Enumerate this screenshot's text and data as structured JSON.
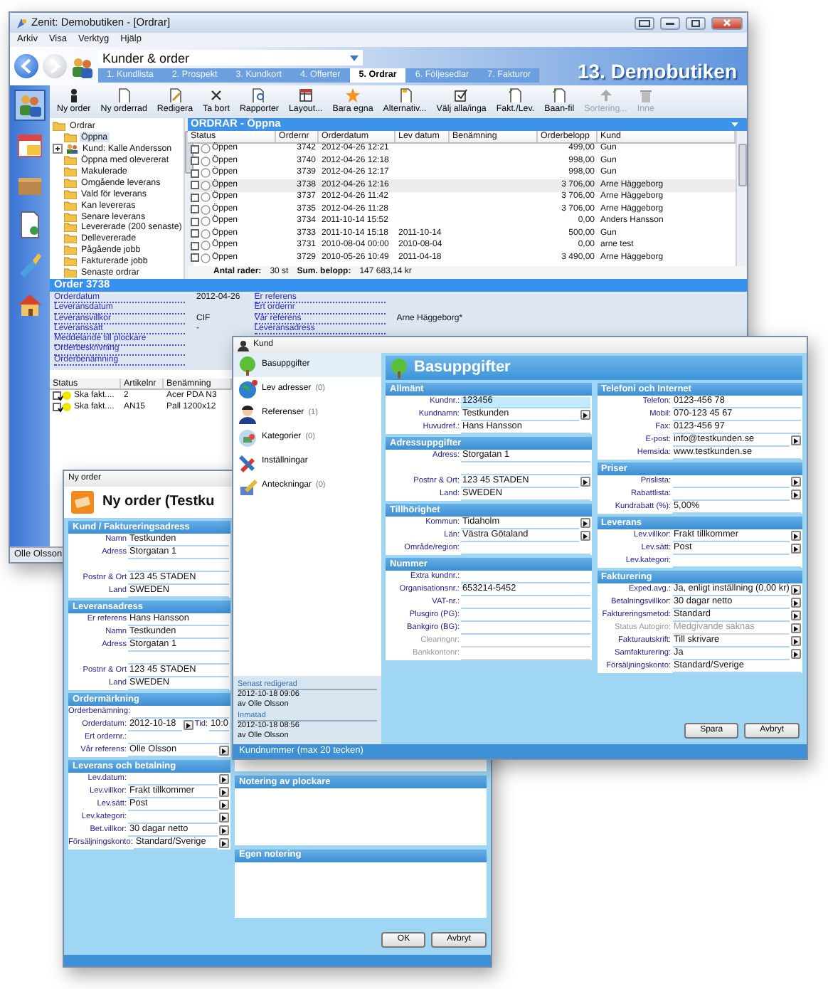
{
  "main_window": {
    "title": "Zenit: Demobutiken - [Ordrar]",
    "menu": [
      "Arkiv",
      "Visa",
      "Verktyg",
      "Hjälp"
    ],
    "nav_dropdown": "Kunder & order",
    "tabs": [
      {
        "label": "1. Kundlista",
        "selected": false
      },
      {
        "label": "2. Prospekt",
        "selected": false
      },
      {
        "label": "3. Kundkort",
        "selected": false
      },
      {
        "label": "4. Offerter",
        "selected": false
      },
      {
        "label": "5. Ordrar",
        "selected": true
      },
      {
        "label": "6. Följesedlar",
        "selected": false
      },
      {
        "label": "7. Fakturor",
        "selected": false
      }
    ],
    "company": "13. Demobutiken",
    "sidebar": [
      {
        "selected": true
      },
      {
        "selected": false
      },
      {
        "selected": false
      },
      {
        "selected": false
      },
      {
        "selected": false
      },
      {
        "selected": false
      }
    ],
    "toolbar": [
      {
        "label": "Ny order",
        "disabled": false
      },
      {
        "label": "Ny orderrad",
        "disabled": false
      },
      {
        "label": "Redigera",
        "disabled": false
      },
      {
        "label": "Ta bort",
        "disabled": false
      },
      {
        "label": "Rapporter",
        "disabled": false
      },
      {
        "label": "Layout...",
        "disabled": false
      },
      {
        "label": "Bara egna",
        "disabled": false
      },
      {
        "label": "Alternativ...",
        "disabled": false
      },
      {
        "label": "Välj alla/inga",
        "disabled": false
      },
      {
        "label": "Fakt./Lev.",
        "disabled": false
      },
      {
        "label": "Baan-fil",
        "disabled": false
      },
      {
        "label": "Sortering...",
        "disabled": true
      },
      {
        "label": "Inne",
        "disabled": true
      }
    ],
    "tree": {
      "label": "Ordrar",
      "expanded": true,
      "children": [
        {
          "label": "Öppna",
          "kind": "folder",
          "selected": true
        },
        {
          "label": "Kund: Kalle Andersson",
          "kind": "customer",
          "selected": false,
          "expanded": false
        },
        {
          "label": "Öppna med olevererat",
          "kind": "folder",
          "selected": false
        },
        {
          "label": "Makulerade",
          "kind": "folder",
          "selected": false
        },
        {
          "label": "Omgående leverans",
          "kind": "folder",
          "selected": false
        },
        {
          "label": "Vald för leverans",
          "kind": "folder",
          "selected": false
        },
        {
          "label": "Kan levereras",
          "kind": "folder",
          "selected": false
        },
        {
          "label": "Senare leverans",
          "kind": "folder",
          "selected": false
        },
        {
          "label": "Levererade (200 senaste)",
          "kind": "folder",
          "selected": false
        },
        {
          "label": "Dellevererade",
          "kind": "folder",
          "selected": false
        },
        {
          "label": "Pågående jobb",
          "kind": "folder",
          "selected": false
        },
        {
          "label": "Fakturerade jobb",
          "kind": "folder",
          "selected": false
        },
        {
          "label": "Senaste ordrar",
          "kind": "folder",
          "selected": false
        }
      ]
    },
    "grid": {
      "title": "ORDRAR - Öppna",
      "columns": [
        "Status",
        "Ordernr",
        "Orderdatum",
        "Lev datum",
        "Benämning",
        "Orderbelopp",
        "Kund"
      ],
      "rows": [
        {
          "checked": false,
          "selected": false,
          "status": "Öppen",
          "ordernr": "3742",
          "orderdatum": "2012-04-26 12:21",
          "belopp": "499,00",
          "kund": "Gun"
        },
        {
          "checked": false,
          "selected": false,
          "status": "Öppen",
          "ordernr": "3740",
          "orderdatum": "2012-04-26 12:18",
          "belopp": "998,00",
          "kund": "Gun"
        },
        {
          "checked": false,
          "selected": false,
          "status": "Öppen",
          "ordernr": "3739",
          "orderdatum": "2012-04-26 12:17",
          "belopp": "998,00",
          "kund": "Gun"
        },
        {
          "checked": false,
          "selected": true,
          "status": "Öppen",
          "ordernr": "3738",
          "orderdatum": "2012-04-26 12:16",
          "belopp": "3 706,00",
          "kund": "Arne Häggeborg"
        },
        {
          "checked": false,
          "selected": false,
          "status": "Öppen",
          "ordernr": "3737",
          "orderdatum": "2012-04-26 11:42",
          "belopp": "3 706,00",
          "kund": "Arne Häggeborg"
        },
        {
          "checked": false,
          "selected": false,
          "status": "Öppen",
          "ordernr": "3735",
          "orderdatum": "2012-04-26 11:28",
          "belopp": "3 706,00",
          "kund": "Arne Häggeborg"
        },
        {
          "checked": false,
          "selected": false,
          "status": "Öppen",
          "ordernr": "3734",
          "orderdatum": "2011-10-14 15:52",
          "belopp": "0,00",
          "kund": "Anders Hansson"
        },
        {
          "checked": false,
          "selected": false,
          "status": "Öppen",
          "ordernr": "3733",
          "orderdatum": "2011-10-14 15:18",
          "lev_datum": "2011-10-14",
          "belopp": "500,00",
          "kund": "Gun"
        },
        {
          "checked": false,
          "selected": false,
          "status": "Öppen",
          "ordernr": "3731",
          "orderdatum": "2010-08-04 00:00",
          "lev_datum": "2010-08-04",
          "belopp": "0,00",
          "kund": "arne test"
        },
        {
          "checked": false,
          "selected": false,
          "status": "Öppen",
          "ordernr": "3729",
          "orderdatum": "2010-05-26 10:49",
          "lev_datum": "2011-04-18",
          "belopp": "3 490,00",
          "kund": "Arne Häggeborg"
        }
      ],
      "footer": [
        {
          "label": "Antal rader:",
          "value": "30 st"
        },
        {
          "label": "Sum. belopp:",
          "value": "147 683,14 kr"
        }
      ]
    },
    "order_panel": {
      "title": "Order 3738",
      "left_fields": [
        {
          "label": "Orderdatum",
          "value": "2012-04-26"
        },
        {
          "label": "Leveransdatum"
        },
        {
          "label": "Leveransvillkor",
          "value": "CIF"
        },
        {
          "label": "Leveranssätt",
          "value": "-"
        },
        {
          "label": "Meddelande till plockare"
        },
        {
          "label": "Orderbeskrivning"
        },
        {
          "label": "Orderbenämning"
        }
      ],
      "right_fields": [
        {
          "label": "Er referens"
        },
        {
          "label": "Ert ordernr"
        },
        {
          "label": "Vår referens",
          "value": "Arne Häggeborg*"
        },
        {
          "label": "Leveransadress"
        }
      ],
      "lines": {
        "columns": [
          "Status",
          "Artikelnr",
          "Benämning"
        ],
        "rows": [
          {
            "checked": true,
            "color": "#f2e600",
            "status": "Ska fakt....",
            "artikelnr": "2",
            "benamning": "Acer PDA N3"
          },
          {
            "checked": true,
            "color": "#f2e600",
            "status": "Ska fakt....",
            "artikelnr": "AN15",
            "benamning": "Pall 1200x12"
          }
        ]
      }
    },
    "status_bar": "Olle Olsson"
  },
  "order_window": {
    "title": "Ny order",
    "heading": "Ny order (Testku",
    "sections": [
      {
        "title": "Kund / Faktureringsadress",
        "fields": [
          {
            "label": "Namn",
            "value": "Testkunden",
            "picker": false
          },
          {
            "label": "Adress",
            "value": "Storgatan 1",
            "picker": false
          },
          {
            "picker": false
          },
          {
            "label": "Postnr & Ort",
            "value": "123 45  STADEN",
            "picker": false
          },
          {
            "label": "Land",
            "value": "SWEDEN",
            "picker": false
          }
        ]
      },
      {
        "title": "Leveransadress",
        "fields": [
          {
            "label": "Er referens",
            "value": "Hans Hansson",
            "picker": false
          },
          {
            "label": "Namn",
            "value": "Testkunden",
            "picker": false
          },
          {
            "label": "Adress",
            "value": "Storgatan 1",
            "picker": false
          },
          {
            "picker": false
          },
          {
            "label": "Postnr & Ort",
            "value": "123 45  STADEN",
            "picker": false
          },
          {
            "label": "Land",
            "value": "SWEDEN",
            "picker": false
          }
        ]
      },
      {
        "title": "Ordermärkning",
        "fields": [
          {
            "label": "Orderbenämning:",
            "picker": false
          },
          {
            "label": "Orderdatum:",
            "value": "2012-10-18",
            "picker": true,
            "extra_label": "Tid:",
            "extra_value": "10:0"
          },
          {
            "label": "Ert ordernr.:",
            "picker": false
          },
          {
            "label": "Vår referens:",
            "value": "Olle Olsson",
            "picker": true
          }
        ]
      },
      {
        "title": "Leverans och betalning",
        "fields": [
          {
            "label": "Lev.datum:",
            "picker": true
          },
          {
            "label": "Lev.villkor:",
            "value": "Frakt tillkommer",
            "picker": true
          },
          {
            "label": "Lev.sätt:",
            "value": "Post",
            "picker": true
          },
          {
            "label": "Lev.kategori:",
            "picker": true
          },
          {
            "label": "Bet.villkor:",
            "value": "30 dagar netto",
            "picker": true
          },
          {
            "label": "Försäljningskonto:",
            "value": "Standard/Sverige",
            "picker": true
          }
        ]
      }
    ],
    "notes": [
      "Notering av plockare",
      "Egen notering"
    ],
    "buttons": [
      "OK",
      "Avbryt"
    ]
  },
  "customer_window": {
    "title": "Kund",
    "nav": [
      {
        "label": "Basuppgifter",
        "selected": true
      },
      {
        "label": "Lev adresser",
        "count": "(0)",
        "selected": false
      },
      {
        "label": "Referenser",
        "count": "(1)",
        "selected": false
      },
      {
        "label": "Kategorier",
        "count": "(0)",
        "selected": false
      },
      {
        "label": "Inställningar",
        "selected": false
      },
      {
        "label": "Anteckningar",
        "count": "(0)",
        "selected": false
      }
    ],
    "meta": [
      {
        "label": "Senast redigerad",
        "date": "2012-10-18 09:06",
        "by": "av Olle Olsson"
      },
      {
        "label": "Inmatad",
        "date": "2012-10-18 08:56",
        "by": "av Olle Olsson"
      }
    ],
    "heading": "Basuppgifter",
    "columns": [
      [
        {
          "title": "Allmänt",
          "fields": [
            {
              "label": "Kundnr.:",
              "value": "123456",
              "picker": false,
              "selected": true,
              "disabled": false
            },
            {
              "label": "Kundnamn:",
              "value": "Testkunden",
              "picker": true,
              "selected": false,
              "disabled": false
            },
            {
              "label": "Huvudref.:",
              "value": "Hans Hansson",
              "picker": false,
              "selected": false,
              "disabled": false
            }
          ]
        },
        {
          "title": "Adressuppgifter",
          "fields": [
            {
              "label": "Adress:",
              "value": "Storgatan 1",
              "picker": false,
              "selected": false,
              "disabled": false
            },
            {
              "picker": false,
              "selected": false,
              "disabled": false
            },
            {
              "label": "Postnr & Ort:",
              "value": "123 45  STADEN",
              "picker": true,
              "selected": false,
              "disabled": false
            },
            {
              "label": "Land:",
              "value": "SWEDEN",
              "picker": false,
              "selected": false,
              "disabled": false
            }
          ]
        },
        {
          "title": "Tillhörighet",
          "fields": [
            {
              "label": "Kommun:",
              "value": "Tidaholm",
              "picker": true,
              "selected": false,
              "disabled": false
            },
            {
              "label": "Län:",
              "value": "Västra Götaland",
              "picker": true,
              "selected": false,
              "disabled": false
            },
            {
              "label": "Område/region:",
              "picker": false,
              "selected": false,
              "disabled": false
            }
          ]
        },
        {
          "title": "Nummer",
          "fields": [
            {
              "label": "Extra kundnr.:",
              "picker": false,
              "selected": false,
              "disabled": false
            },
            {
              "label": "Organisationsnr.:",
              "value": "653214-5452",
              "picker": false,
              "selected": false,
              "disabled": false
            },
            {
              "label": "VAT-nr.:",
              "picker": false,
              "selected": false,
              "disabled": false
            },
            {
              "label": "Plusgiro (PG):",
              "picker": false,
              "selected": false,
              "disabled": false
            },
            {
              "label": "Bankgiro (BG):",
              "picker": false,
              "selected": false,
              "disabled": false
            },
            {
              "label": "Clearingnr:",
              "picker": false,
              "selected": false,
              "disabled": true
            },
            {
              "label": "Bankkontonr:",
              "picker": false,
              "selected": false,
              "disabled": true
            }
          ]
        }
      ],
      [
        {
          "title": "Telefoni och Internet",
          "fields": [
            {
              "label": "Telefon:",
              "value": "0123-456 78",
              "picker": false,
              "selected": false,
              "disabled": false
            },
            {
              "label": "Mobil:",
              "value": "070-123 45 67",
              "picker": false,
              "selected": false,
              "disabled": false
            },
            {
              "label": "Fax:",
              "value": "0123-456 97",
              "picker": false,
              "selected": false,
              "disabled": false
            },
            {
              "label": "E-post:",
              "value": "info@testkunden.se",
              "picker": true,
              "selected": false,
              "disabled": false
            },
            {
              "label": "Hemsida:",
              "value": "www.testkunden.se",
              "picker": false,
              "selected": false,
              "disabled": false
            }
          ]
        },
        {
          "title": "Priser",
          "fields": [
            {
              "label": "Prislista:",
              "picker": true,
              "selected": false,
              "disabled": false
            },
            {
              "label": "Rabattlista:",
              "picker": true,
              "selected": false,
              "disabled": false
            },
            {
              "label": "Kundrabatt (%):",
              "value": "5,00%",
              "picker": false,
              "selected": false,
              "disabled": false
            }
          ]
        },
        {
          "title": "Leverans",
          "fields": [
            {
              "label": "Lev.villkor:",
              "value": "Frakt tillkommer",
              "picker": true,
              "selected": false,
              "disabled": false
            },
            {
              "label": "Lev.sätt:",
              "value": "Post",
              "picker": true,
              "selected": false,
              "disabled": false
            },
            {
              "label": "Lev.kategori:",
              "picker": false,
              "selected": false,
              "disabled": false
            }
          ]
        },
        {
          "title": "Fakturering",
          "fields": [
            {
              "label": "Exped.avg.:",
              "value": "Ja, enligt inställning (0,00 kr)",
              "picker": true,
              "selected": false,
              "disabled": false
            },
            {
              "label": "Betalningsvillkor:",
              "value": "30 dagar netto",
              "picker": true,
              "selected": false,
              "disabled": false
            },
            {
              "label": "Faktureringsmetod:",
              "value": "Standard",
              "picker": true,
              "selected": false,
              "disabled": false
            },
            {
              "label": "Status Autogiro:",
              "value": "Medgivande saknas",
              "picker": true,
              "selected": false,
              "disabled": true
            },
            {
              "label": "Fakturautskrift:",
              "value": "Till skrivare",
              "picker": true,
              "selected": false,
              "disabled": false
            },
            {
              "label": "Samfakturering:",
              "value": "Ja",
              "picker": true,
              "selected": false,
              "disabled": false
            },
            {
              "label": "Försäljningskonto:",
              "value": "Standard/Sverige",
              "picker": false,
              "selected": false,
              "disabled": false
            }
          ]
        }
      ]
    ],
    "buttons": [
      "Spara",
      "Avbryt"
    ],
    "status_bar": "Kundnummer (max 20 tecken)"
  }
}
